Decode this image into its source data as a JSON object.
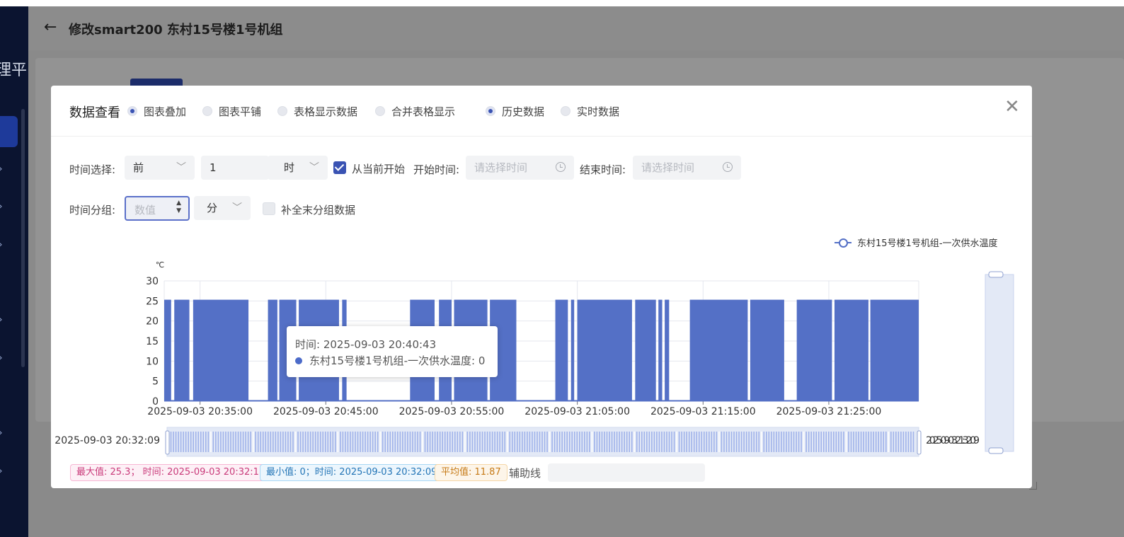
{
  "page": {
    "title": "修改smart200 东村15号楼1号机组",
    "nav_fragment": "理平"
  },
  "modal": {
    "title": "数据查看",
    "view_modes": [
      {
        "label": "图表叠加",
        "selected": true
      },
      {
        "label": "图表平铺",
        "selected": false
      },
      {
        "label": "表格显示数据",
        "selected": false
      },
      {
        "label": "合并表格显示",
        "selected": false
      }
    ],
    "data_modes": [
      {
        "label": "历史数据",
        "selected": true
      },
      {
        "label": "实时数据",
        "selected": false
      }
    ],
    "close_icon": "close-icon"
  },
  "filters": {
    "time_select_label": "时间选择:",
    "range_option": "前",
    "amount": "1",
    "unit": "时",
    "from_now_label": "从当前开始",
    "from_now_checked": true,
    "start_label": "开始时间:",
    "start_placeholder": "请选择时间",
    "end_label": "结束时间:",
    "end_placeholder": "请选择时间",
    "group_label": "时间分组:",
    "group_placeholder": "数值",
    "group_unit": "分",
    "fill_label": "补全末分组数据",
    "fill_checked": false
  },
  "chart_data": {
    "type": "area",
    "ylabel": "℃",
    "ylim": [
      0,
      30
    ],
    "yticks": [
      "0",
      "5",
      "10",
      "15",
      "20",
      "25",
      "30"
    ],
    "xticks": [
      "2025-09-03 20:35:00",
      "2025-09-03 20:45:00",
      "2025-09-03 20:55:00",
      "2025-09-03 21:05:00",
      "2025-09-03 21:15:00",
      "2025-09-03 21:25:00"
    ],
    "x_start": "2025-09-03 20:32:09",
    "x_end": "2025-09-03 21:32:09",
    "legend_position": "top-right",
    "grid": true,
    "series": [
      {
        "name": "东村15号楼1号机组-一次供水温度",
        "color": "#5470c6",
        "high_value": 25.3,
        "low_value": 0,
        "segments_minutes": [
          [
            0.0,
            0.55
          ],
          [
            0.8,
            2.0
          ],
          [
            2.3,
            6.7
          ],
          [
            8.25,
            9.0
          ],
          [
            9.15,
            10.5
          ],
          [
            10.7,
            13.9
          ],
          [
            14.15,
            14.5
          ],
          [
            19.55,
            21.5
          ],
          [
            21.85,
            22.85
          ],
          [
            23.05,
            25.7
          ],
          [
            25.9,
            28.0
          ],
          [
            31.1,
            32.1
          ],
          [
            32.35,
            32.6
          ],
          [
            32.85,
            37.2
          ],
          [
            37.45,
            39.1
          ],
          [
            39.3,
            39.6
          ],
          [
            39.8,
            40.15
          ],
          [
            41.8,
            46.4
          ],
          [
            46.6,
            49.3
          ],
          [
            50.3,
            53.1
          ],
          [
            53.3,
            56.0
          ],
          [
            56.15,
            60.0
          ]
        ]
      }
    ],
    "tooltip": {
      "time": "时间: 2025-09-03 20:40:43",
      "value_text": "东村15号楼1号机组-一次供水温度: 0"
    }
  },
  "stats": {
    "max": "最大值: 25.3；  时间: 2025-09-03 20:32:11",
    "min": "最小值: 0；时间: 2025-09-03 20:32:09",
    "avg": "平均值: 11.87",
    "aux_label": "辅助线"
  }
}
